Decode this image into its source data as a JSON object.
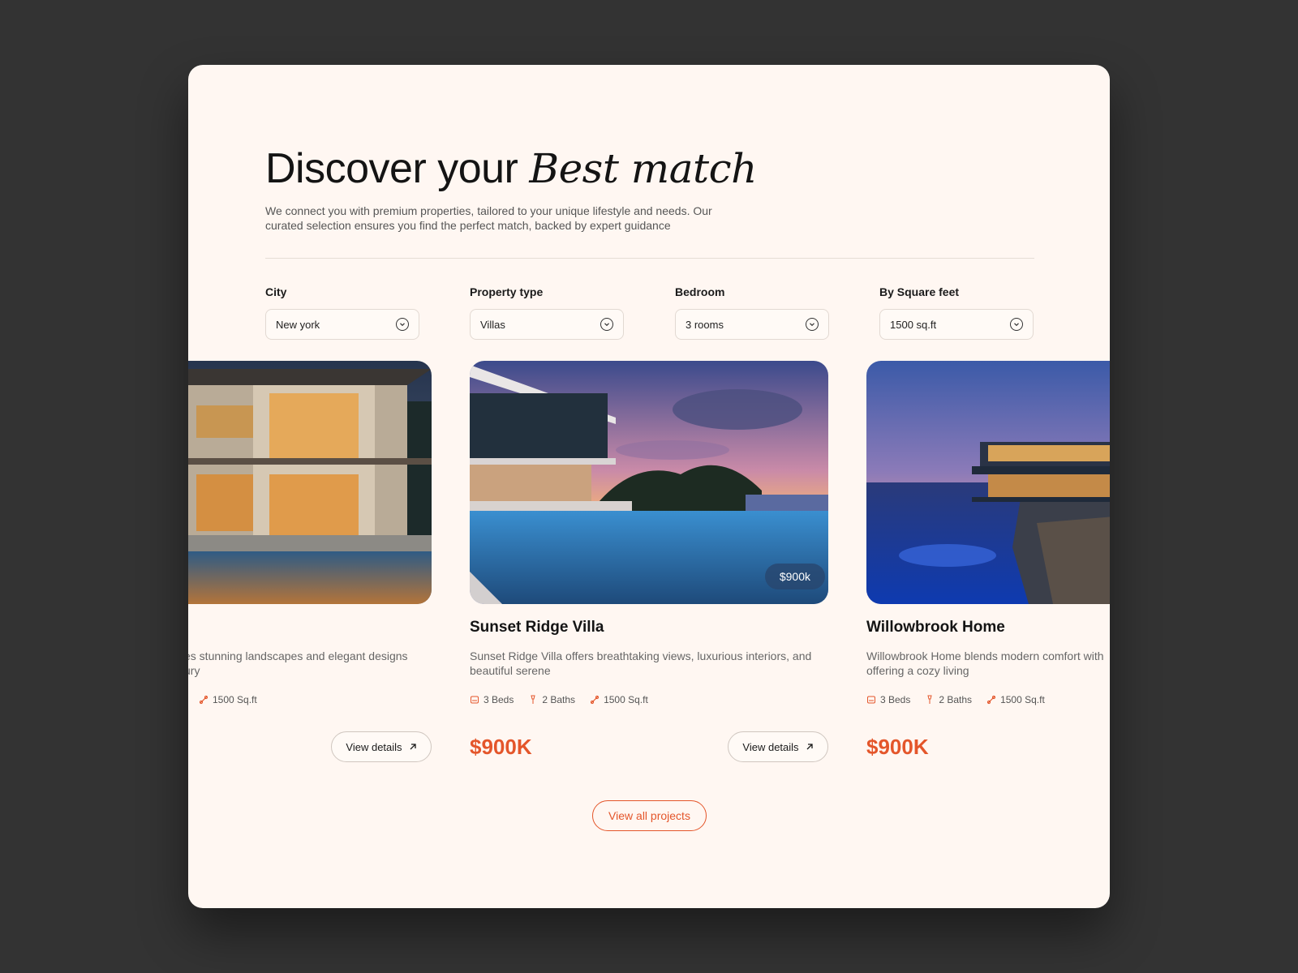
{
  "header": {
    "title_plain": "Discover your",
    "title_italic": "Best match",
    "description": "We connect you with premium properties, tailored to your unique lifestyle and needs. Our curated selection ensures you find the perfect match, backed by expert guidance"
  },
  "filters": [
    {
      "label": "City",
      "value": "New york"
    },
    {
      "label": "Property type",
      "value": "Villas"
    },
    {
      "label": "Bedroom",
      "value": "3 rooms"
    },
    {
      "label": "By Square feet",
      "value": "1500 sq.ft"
    }
  ],
  "cards": [
    {
      "title": "",
      "desc_line1": "es stunning landscapes and elegant designs",
      "desc_line2": "ury",
      "sqft": "1500 Sq.ft",
      "view_label": "View details"
    },
    {
      "title": "Sunset Ridge Villa",
      "desc_line1": "Sunset Ridge Villa offers breathtaking views, luxurious interiors, and",
      "desc_line2": "beautiful serene",
      "beds": "3 Beds",
      "baths": "2 Baths",
      "sqft": "1500 Sq.ft",
      "price": "$900K",
      "badge": "$900k",
      "view_label": "View details"
    },
    {
      "title": "Willowbrook Home",
      "desc_line1": "Willowbrook Home blends modern comfort with",
      "desc_line2": "offering a cozy living",
      "beds": "3 Beds",
      "baths": "2 Baths",
      "sqft": "1500 Sq.ft",
      "price": "$900K"
    }
  ],
  "view_all_label": "View all projects",
  "colors": {
    "accent": "#e4562b",
    "background": "#fff7f2",
    "page": "#333333"
  }
}
